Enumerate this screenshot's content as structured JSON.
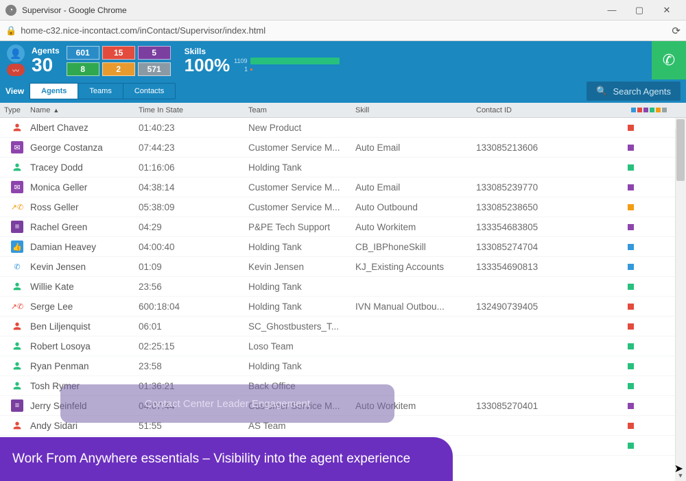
{
  "window": {
    "title": "Supervisor - Google Chrome",
    "url": "home-c32.nice-incontact.com/inContact/Supervisor/index.html"
  },
  "header": {
    "agents_label": "Agents",
    "agents_count": "30",
    "states": [
      {
        "value": "601",
        "cls": "sc-blue"
      },
      {
        "value": "15",
        "cls": "sc-red"
      },
      {
        "value": "5",
        "cls": "sc-purple"
      },
      {
        "value": "8",
        "cls": "sc-green"
      },
      {
        "value": "2",
        "cls": "sc-orange"
      },
      {
        "value": "571",
        "cls": "sc-grey"
      }
    ],
    "skills_label": "Skills",
    "skills_percent": "100%",
    "skills_small_top": "1109",
    "skills_small_bottom": "1"
  },
  "viewbar": {
    "label": "View",
    "tabs": [
      {
        "label": "Agents",
        "active": true
      },
      {
        "label": "Teams",
        "active": false
      },
      {
        "label": "Contacts",
        "active": false
      }
    ],
    "search_placeholder": "Search Agents"
  },
  "columns": {
    "type": "Type",
    "name": "Name",
    "time": "Time In State",
    "team": "Team",
    "skill": "Skill",
    "contact": "Contact ID"
  },
  "rows": [
    {
      "icon": "person-red",
      "name": "Albert Chavez",
      "time": "01:40:23",
      "team": "New Product",
      "skill": "",
      "contact": "",
      "ind": "red"
    },
    {
      "icon": "mail",
      "name": "George Costanza",
      "time": "07:44:23",
      "team": "Customer Service M...",
      "skill": "Auto Email",
      "contact": "133085213606",
      "ind": "purple"
    },
    {
      "icon": "person-green",
      "name": "Tracey Dodd",
      "time": "01:16:06",
      "team": "Holding Tank",
      "skill": "",
      "contact": "",
      "ind": "green"
    },
    {
      "icon": "mail",
      "name": "Monica Geller",
      "time": "04:38:14",
      "team": "Customer Service M...",
      "skill": "Auto Email",
      "contact": "133085239770",
      "ind": "purple"
    },
    {
      "icon": "phone-out",
      "name": "Ross Geller",
      "time": "05:38:09",
      "team": "Customer Service M...",
      "skill": "Auto Outbound",
      "contact": "133085238650",
      "ind": "orange"
    },
    {
      "icon": "work",
      "name": "Rachel Green",
      "time": "04:29",
      "team": "P&PE Tech Support",
      "skill": "Auto Workitem",
      "contact": "133354683805",
      "ind": "purple"
    },
    {
      "icon": "thumb",
      "name": "Damian Heavey",
      "time": "04:00:40",
      "team": "Holding Tank",
      "skill": "CB_IBPhoneSkill",
      "contact": "133085274704",
      "ind": "blue"
    },
    {
      "icon": "phone-blue",
      "name": "Kevin Jensen",
      "time": "01:09",
      "team": "Kevin Jensen",
      "skill": "KJ_Existing Accounts",
      "contact": "133354690813",
      "ind": "blue"
    },
    {
      "icon": "person-green",
      "name": "Willie Kate",
      "time": "23:56",
      "team": "Holding Tank",
      "skill": "",
      "contact": "",
      "ind": "green"
    },
    {
      "icon": "phone-missed",
      "name": "Serge Lee",
      "time": "600:18:04",
      "team": "Holding Tank",
      "skill": "IVN Manual Outbou...",
      "contact": "132490739405",
      "ind": "red"
    },
    {
      "icon": "person-red",
      "name": "Ben Liljenquist",
      "time": "06:01",
      "team": "SC_Ghostbusters_T...",
      "skill": "",
      "contact": "",
      "ind": "red"
    },
    {
      "icon": "person-green",
      "name": "Robert Losoya",
      "time": "02:25:15",
      "team": "Loso Team",
      "skill": "",
      "contact": "",
      "ind": "green"
    },
    {
      "icon": "person-green",
      "name": "Ryan Penman",
      "time": "23:58",
      "team": "Holding Tank",
      "skill": "",
      "contact": "",
      "ind": "green"
    },
    {
      "icon": "person-green",
      "name": "Tosh Rymer",
      "time": "01:36:21",
      "team": "Back Office",
      "skill": "",
      "contact": "",
      "ind": "green"
    },
    {
      "icon": "work",
      "name": "Jerry Seinfeld",
      "time": "04:07:44",
      "team": "Customer Service M...",
      "skill": "Auto Workitem",
      "contact": "133085270401",
      "ind": "purple"
    },
    {
      "icon": "person-red",
      "name": "Andy Sidari",
      "time": "51:55",
      "team": "AS Team",
      "skill": "",
      "contact": "",
      "ind": "red"
    },
    {
      "icon": "person-green",
      "name": "",
      "time": "",
      "team": "",
      "skill": "",
      "contact": "",
      "ind": "green"
    }
  ],
  "overlay": {
    "pill": "Contact Center Leader Engagement",
    "banner": "Work From Anywhere essentials – Visibility into the agent experience"
  }
}
